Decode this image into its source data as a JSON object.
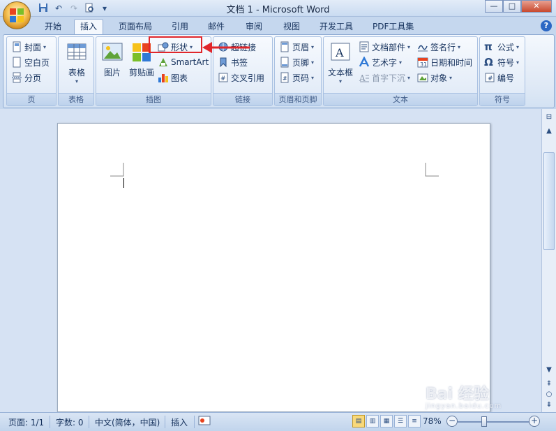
{
  "window": {
    "title": "文档 1 - Microsoft Word",
    "minimize": "—",
    "maximize": "□",
    "close": "✕"
  },
  "qat": [
    "save-icon",
    "undo-icon",
    "redo-icon",
    "print-preview-icon",
    "customize-icon"
  ],
  "tabs": [
    {
      "label": "开始",
      "active": false
    },
    {
      "label": "插入",
      "active": true
    },
    {
      "label": "页面布局",
      "active": false
    },
    {
      "label": "引用",
      "active": false
    },
    {
      "label": "邮件",
      "active": false
    },
    {
      "label": "审阅",
      "active": false
    },
    {
      "label": "视图",
      "active": false
    },
    {
      "label": "开发工具",
      "active": false
    },
    {
      "label": "PDF工具集",
      "active": false
    }
  ],
  "ribbon": {
    "pages": {
      "label": "页",
      "cover": "封面",
      "blank": "空白页",
      "break": "分页"
    },
    "tables": {
      "label": "表格",
      "table": "表格"
    },
    "illustrations": {
      "label": "插图",
      "picture": "图片",
      "clipart": "剪贴画",
      "shapes": "形状",
      "smartart": "SmartArt",
      "chart": "图表"
    },
    "links": {
      "label": "链接",
      "hyperlink": "超链接",
      "bookmark": "书签",
      "crossref": "交叉引用"
    },
    "header_footer": {
      "label": "页眉和页脚",
      "header": "页眉",
      "footer": "页脚",
      "page_number": "页码"
    },
    "text": {
      "label": "文本",
      "textbox": "文本框",
      "quickparts": "文档部件",
      "wordart": "艺术字",
      "dropcap": "首字下沉",
      "signature": "签名行",
      "datetime": "日期和时间",
      "object": "对象"
    },
    "symbols": {
      "label": "符号",
      "equation": "公式",
      "symbol": "符号",
      "number": "编号"
    }
  },
  "status": {
    "page": "页面: 1/1",
    "words": "字数: 0",
    "language": "中文(简体，中国)",
    "mode": "插入",
    "zoom": "78%",
    "zoom_level": 0.78
  },
  "watermark": {
    "text": "Bai 经验",
    "sub": "jingyan.baidu.com"
  },
  "colors": {
    "accent": "#e0262b",
    "ribbon_bg": "#dfe9f6",
    "text": "#15315c"
  }
}
